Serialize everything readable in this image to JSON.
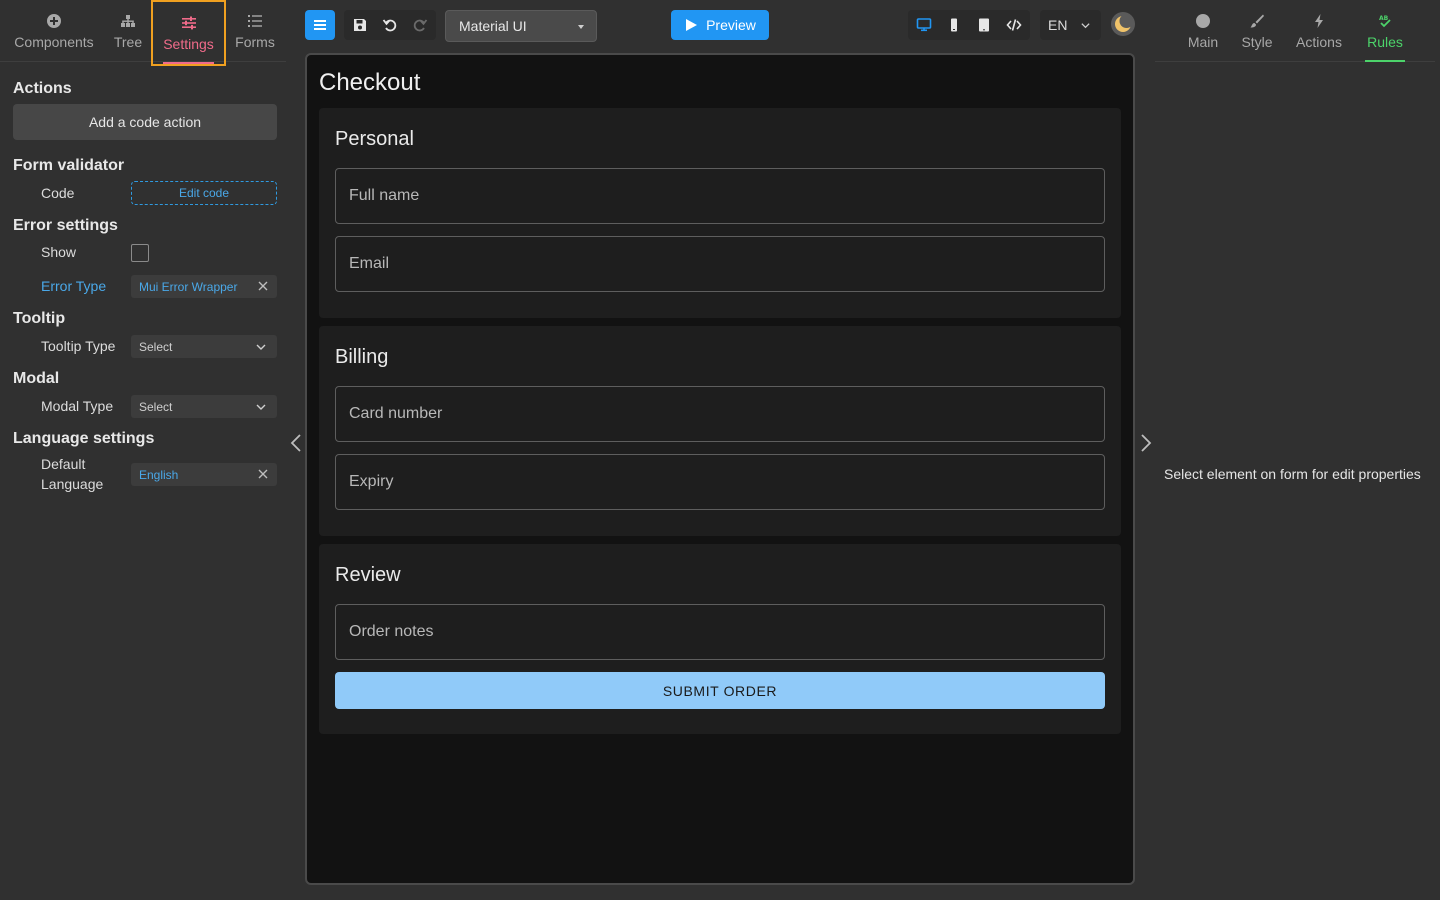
{
  "left_tabs": [
    {
      "label": "Components",
      "icon": "plus-circle-icon"
    },
    {
      "label": "Tree",
      "icon": "tree-icon"
    },
    {
      "label": "Settings",
      "icon": "sliders-icon",
      "active": true
    },
    {
      "label": "Forms",
      "icon": "list-icon"
    }
  ],
  "settings": {
    "actions_title": "Actions",
    "add_code_action_label": "Add a code action",
    "form_validator_title": "Form validator",
    "code_label": "Code",
    "edit_code_label": "Edit code",
    "error_settings_title": "Error settings",
    "show_label": "Show",
    "show_checked": false,
    "error_type_label": "Error Type",
    "error_type_value": "Mui Error Wrapper",
    "tooltip_title": "Tooltip",
    "tooltip_type_label": "Tooltip Type",
    "tooltip_type_value": "Select",
    "modal_title": "Modal",
    "modal_type_label": "Modal Type",
    "modal_type_value": "Select",
    "language_title": "Language settings",
    "default_language_label_1": "Default",
    "default_language_label_2": "Language",
    "default_language_value": "English"
  },
  "toolbar": {
    "ui_library": "Material UI",
    "preview_label": "Preview",
    "language": "EN"
  },
  "form": {
    "title": "Checkout",
    "sections": [
      {
        "title": "Personal",
        "fields": [
          "Full name",
          "Email"
        ]
      },
      {
        "title": "Billing",
        "fields": [
          "Card number",
          "Expiry"
        ]
      },
      {
        "title": "Review",
        "fields": [
          "Order notes"
        ]
      }
    ],
    "submit_label": "SUBMIT ORDER"
  },
  "right_tabs": [
    {
      "label": "Main",
      "icon": "circle-icon"
    },
    {
      "label": "Style",
      "icon": "brush-icon"
    },
    {
      "label": "Actions",
      "icon": "lightning-icon"
    },
    {
      "label": "Rules",
      "icon": "rules-check-icon",
      "active": true
    }
  ],
  "right_panel": {
    "hint": "Select element on form for edit properties"
  },
  "colors": {
    "accent_blue": "#2196f3",
    "settings_tab": "#f06b8a",
    "rules_tab": "#4cd36a",
    "highlight_box": "#f0a020"
  }
}
